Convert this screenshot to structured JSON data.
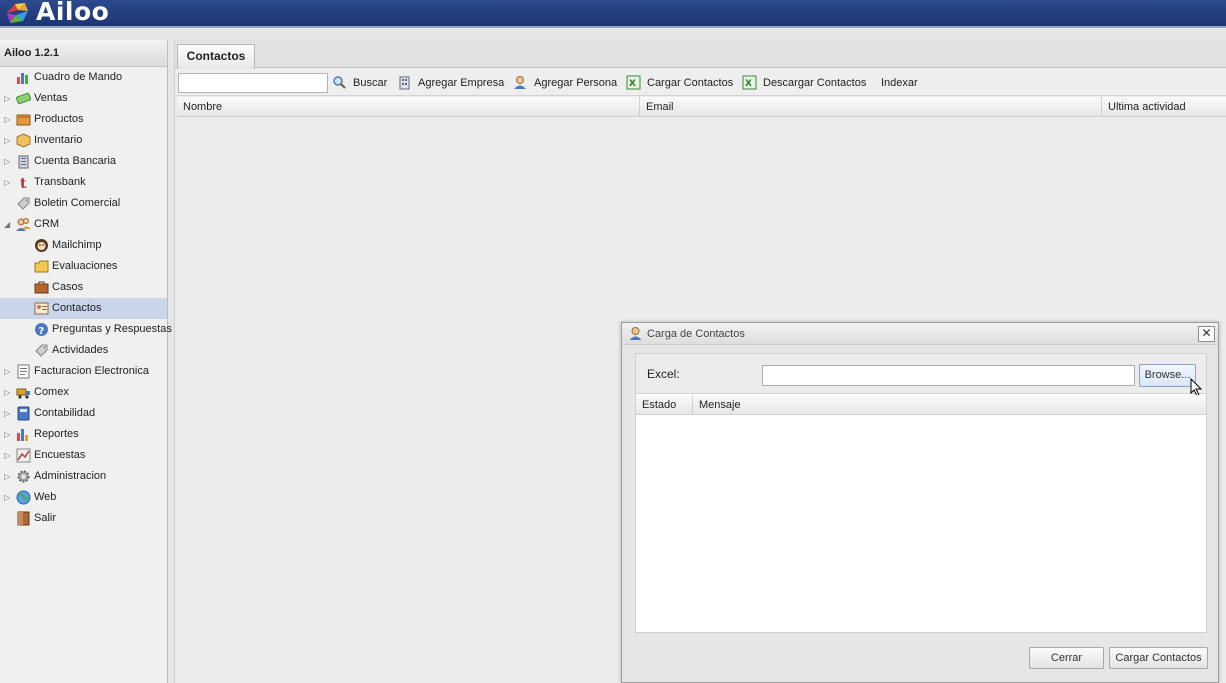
{
  "app": {
    "brand": "Ailoo",
    "version_title": "Ailoo 1.2.1"
  },
  "sidebar": {
    "items": [
      {
        "label": "Cuadro de Mando",
        "icon": "chart-icon",
        "expandable": false,
        "indent": 0
      },
      {
        "label": "Ventas",
        "icon": "money-icon",
        "expandable": true,
        "indent": 0
      },
      {
        "label": "Productos",
        "icon": "box-icon",
        "expandable": true,
        "indent": 0
      },
      {
        "label": "Inventario",
        "icon": "package-icon",
        "expandable": true,
        "indent": 0
      },
      {
        "label": "Cuenta Bancaria",
        "icon": "bank-icon",
        "expandable": true,
        "indent": 0
      },
      {
        "label": "Transbank",
        "icon": "transbank-icon",
        "expandable": true,
        "indent": 0
      },
      {
        "label": "Boletin Comercial",
        "icon": "tag-icon",
        "expandable": false,
        "indent": 0
      },
      {
        "label": "CRM",
        "icon": "users-icon",
        "expandable": true,
        "expanded": true,
        "indent": 0
      },
      {
        "label": "Mailchimp",
        "icon": "mailchimp-icon",
        "expandable": false,
        "indent": 1
      },
      {
        "label": "Evaluaciones",
        "icon": "folder-icon",
        "expandable": false,
        "indent": 1
      },
      {
        "label": "Casos",
        "icon": "briefcase-icon",
        "expandable": false,
        "indent": 1
      },
      {
        "label": "Contactos",
        "icon": "contact-card-icon",
        "expandable": false,
        "indent": 1,
        "selected": true
      },
      {
        "label": "Preguntas y Respuestas",
        "icon": "help-icon",
        "expandable": false,
        "indent": 1
      },
      {
        "label": "Actividades",
        "icon": "tag-icon",
        "expandable": false,
        "indent": 1
      },
      {
        "label": "Facturacion Electronica",
        "icon": "document-icon",
        "expandable": true,
        "indent": 0
      },
      {
        "label": "Comex",
        "icon": "truck-icon",
        "expandable": true,
        "indent": 0
      },
      {
        "label": "Contabilidad",
        "icon": "calculator-icon",
        "expandable": true,
        "indent": 0
      },
      {
        "label": "Reportes",
        "icon": "bar-chart-icon",
        "expandable": true,
        "indent": 0
      },
      {
        "label": "Encuestas",
        "icon": "survey-icon",
        "expandable": true,
        "indent": 0
      },
      {
        "label": "Administracion",
        "icon": "gear-icon",
        "expandable": true,
        "indent": 0
      },
      {
        "label": "Web",
        "icon": "globe-icon",
        "expandable": true,
        "indent": 0
      },
      {
        "label": "Salir",
        "icon": "door-icon",
        "expandable": false,
        "indent": 0
      }
    ]
  },
  "main": {
    "tab_label": "Contactos",
    "toolbar": {
      "search_value": "",
      "buscar": "Buscar",
      "agregar_empresa": "Agregar Empresa",
      "agregar_persona": "Agregar Persona",
      "cargar_contactos": "Cargar Contactos",
      "descargar_contactos": "Descargar Contactos",
      "indexar": "Indexar"
    },
    "columns": [
      "Nombre",
      "Email",
      "Ultima actividad"
    ]
  },
  "dialog": {
    "title": "Carga de Contactos",
    "close_symbol": "✕",
    "excel_label": "Excel:",
    "excel_value": "",
    "browse_label": "Browse...",
    "columns": [
      "Estado",
      "Mensaje"
    ],
    "cerrar_label": "Cerrar",
    "cargar_label": "Cargar Contactos"
  },
  "colors": {
    "header_bg": "#1d3574",
    "selected_bg": "#c9d6ea"
  }
}
